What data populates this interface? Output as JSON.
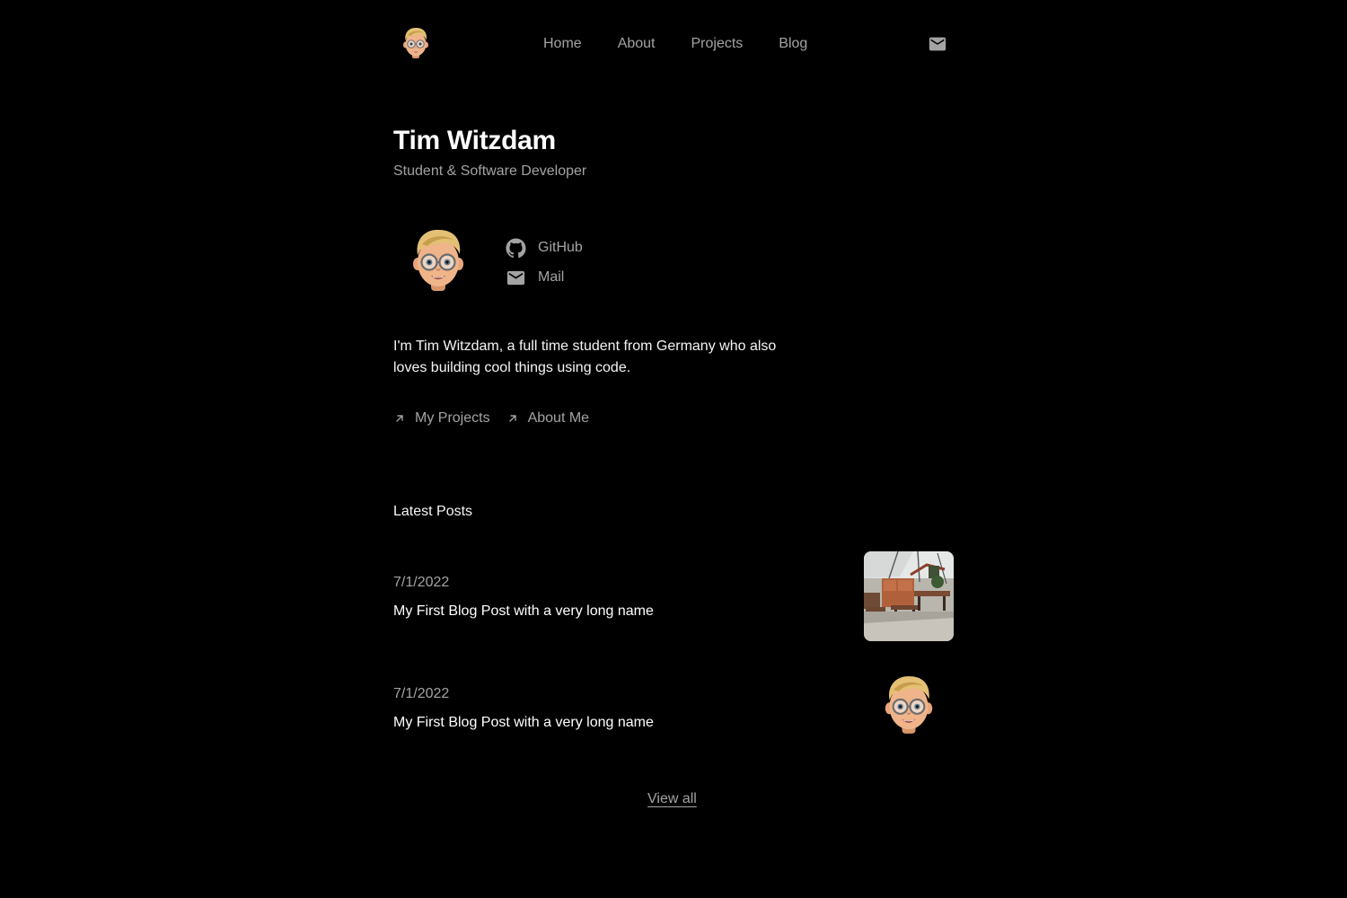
{
  "nav": {
    "links": [
      {
        "label": "Home"
      },
      {
        "label": "About"
      },
      {
        "label": "Projects"
      },
      {
        "label": "Blog"
      }
    ],
    "mail_icon": "mail-icon"
  },
  "hero": {
    "name": "Tim Witzdam",
    "role": "Student & Software Developer",
    "social": [
      {
        "label": "GitHub",
        "icon": "github-icon"
      },
      {
        "label": "Mail",
        "icon": "mail-icon"
      }
    ],
    "bio": "I'm Tim Witzdam, a full time student from Germany who also loves building cool things using code.",
    "cta": [
      {
        "label": "My Projects",
        "icon": "arrow-up-right-icon"
      },
      {
        "label": "About Me",
        "icon": "arrow-up-right-icon"
      }
    ]
  },
  "posts": {
    "heading": "Latest Posts",
    "items": [
      {
        "date": "7/1/2022",
        "title": "My First Blog Post with a very long name",
        "thumbnail": "cafe-photo"
      },
      {
        "date": "7/1/2022",
        "title": "My First Blog Post with a very long name",
        "thumbnail": "memoji-avatar"
      }
    ],
    "view_all": "View all"
  },
  "colors": {
    "background": "#000000",
    "text": "#ffffff",
    "muted": "#a3a3a3"
  }
}
